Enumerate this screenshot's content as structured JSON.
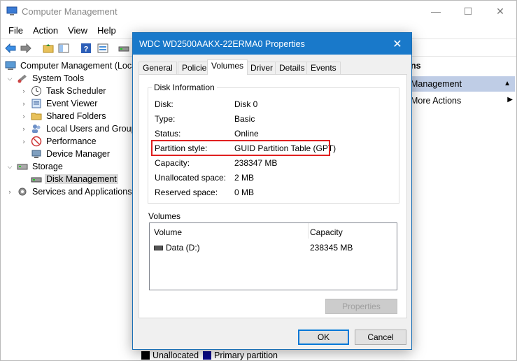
{
  "window": {
    "title": "Computer Management",
    "minimize_glyph": "—",
    "maximize_glyph": "☐",
    "close_glyph": "✕"
  },
  "menu": [
    "File",
    "Action",
    "View",
    "Help"
  ],
  "toolbar_icons": [
    "back-arrow-icon",
    "forward-arrow-icon",
    "up-folder-icon",
    "show-hide-tree-icon",
    "help-icon",
    "properties-icon",
    "disk-icon"
  ],
  "tree": {
    "root": "Computer Management (Local",
    "system_tools": "System Tools",
    "task_scheduler": "Task Scheduler",
    "event_viewer": "Event Viewer",
    "shared_folders": "Shared Folders",
    "local_users": "Local Users and Groups",
    "performance": "Performance",
    "device_manager": "Device Manager",
    "storage": "Storage",
    "disk_management": "Disk Management",
    "services": "Services and Applications"
  },
  "actions": {
    "heading": "ns",
    "section": "Management",
    "more": "More Actions"
  },
  "legend": {
    "unallocated": "Unallocated",
    "primary": "Primary partition",
    "colors": {
      "unallocated": "#000000",
      "primary": "#0a0a8c"
    }
  },
  "dialog": {
    "title": "WDC WD2500AAKX-22ERMA0 Properties",
    "close_glyph": "✕",
    "tabs": [
      "General",
      "Policies",
      "Volumes",
      "Driver",
      "Details",
      "Events"
    ],
    "active_tab": "Volumes",
    "disk_info": {
      "group_label": "Disk Information",
      "rows": [
        {
          "label": "Disk:",
          "value": "Disk 0"
        },
        {
          "label": "Type:",
          "value": "Basic"
        },
        {
          "label": "Status:",
          "value": "Online"
        },
        {
          "label": "Partition style:",
          "value": "GUID Partition Table (GPT)"
        },
        {
          "label": "Capacity:",
          "value": "238347 MB"
        },
        {
          "label": "Unallocated space:",
          "value": "2 MB"
        },
        {
          "label": "Reserved space:",
          "value": "0 MB"
        }
      ]
    },
    "volumes": {
      "label": "Volumes",
      "columns": [
        "Volume",
        "Capacity"
      ],
      "rows": [
        {
          "volume": "Data (D:)",
          "capacity": "238345 MB"
        }
      ]
    },
    "properties_button": "Properties",
    "ok_button": "OK",
    "cancel_button": "Cancel",
    "highlight_color": "#e02020",
    "accent_color": "#1979ca"
  }
}
